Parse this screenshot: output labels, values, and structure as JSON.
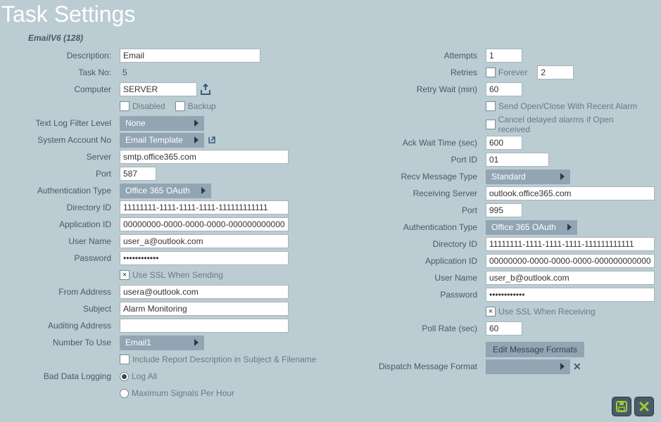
{
  "title": "Task Settings",
  "subtitle": "EmailV6 (128)",
  "left": {
    "description_label": "Description:",
    "description_value": "Email",
    "taskno_label": "Task No:",
    "taskno_value": "5",
    "computer_label": "Computer",
    "computer_value": "SERVER",
    "disabled_label": "Disabled",
    "backup_label": "Backup",
    "textlog_label": "Text Log Filter Level",
    "textlog_value": "None",
    "sysacc_label": "System Account No",
    "sysacc_value": "Email Template",
    "server_label": "Server",
    "server_value": "smtp.office365.com",
    "port_label": "Port",
    "port_value": "587",
    "authtype_label": "Authentication Type",
    "authtype_value": "Office 365 OAuth",
    "dirid_label": "Directory ID",
    "dirid_value": "11111111-1111-1111-1111-111111111111",
    "appid_label": "Application ID",
    "appid_value": "00000000-0000-0000-0000-000000000000",
    "username_label": "User Name",
    "username_value": "user_a@outlook.com",
    "password_label": "Password",
    "password_value": "••••••••••••",
    "usessl_label": "Use SSL When Sending",
    "from_label": "From Address",
    "from_value": "usera@outlook.com",
    "subject_label": "Subject",
    "subject_value": "Alarm Monitoring",
    "audit_label": "Auditing Address",
    "audit_value": "",
    "numtouse_label": "Number To Use",
    "numtouse_value": "Email1",
    "includereport_label": "Include Report Description in Subject & Filename",
    "baddata_label": "Bad Data Logging",
    "logall_label": "Log All",
    "maxsig_label": "Maximum Signals Per Hour"
  },
  "right": {
    "attempts_label": "Attempts",
    "attempts_value": "1",
    "retries_label": "Retries",
    "forever_label": "Forever",
    "retries_value": "2",
    "retrywait_label": "Retry Wait (min)",
    "retrywait_value": "60",
    "sendopen_label": "Send Open/Close With Recent Alarm",
    "canceldelayed_label": "Cancel delayed alarms if Open received",
    "ackwait_label": "Ack Wait Time (sec)",
    "ackwait_value": "600",
    "portid_label": "Port ID",
    "portid_value": "01",
    "recvmsg_label": "Recv Message Type",
    "recvmsg_value": "Standard",
    "recvserver_label": "Receiving Server",
    "recvserver_value": "outlook.office365.com",
    "port2_label": "Port",
    "port2_value": "995",
    "authtype2_label": "Authentication Type",
    "authtype2_value": "Office 365 OAuth",
    "dirid2_label": "Directory ID",
    "dirid2_value": "11111111-1111-1111-1111-111111111111",
    "appid2_label": "Application ID",
    "appid2_value": "00000000-0000-0000-0000-000000000000",
    "username2_label": "User Name",
    "username2_value": "user_b@outlook.com",
    "password2_label": "Password",
    "password2_value": "••••••••••••",
    "usessl2_label": "Use SSL When Receiving",
    "pollrate_label": "Poll Rate (sec)",
    "pollrate_value": "60",
    "editmsg_label": "Edit Message Formats",
    "dispatchmsg_label": "Dispatch Message Format"
  }
}
